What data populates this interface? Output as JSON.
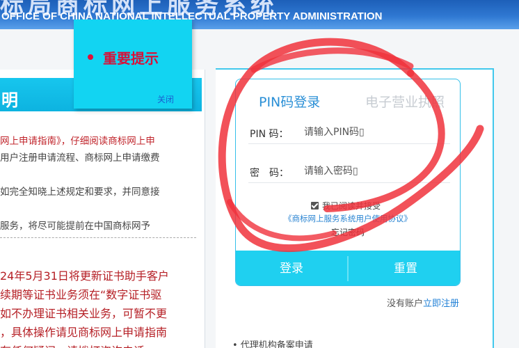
{
  "header": {
    "title_en": "OFFICE OF CHINA NATIONAL INTELLECTUAL PROPERTY ADMINISTRATION",
    "title_cn": "标局商标网上服务系统"
  },
  "popup": {
    "title": "重要提示",
    "close_label": "关闭"
  },
  "notice": {
    "heading": "明",
    "lines": [
      "网上申请指南》，仔细阅读商标网上申",
      "用户注册申请流程、商标网上申请缴费",
      "如完全知晓上述规定和要求，并同意接",
      "服务，将尽可能提前在中国商标网予"
    ],
    "red_lines": [
      "24年5月31日将更新证书助手客户",
      "续期等证书业务须在“数字证书驱",
      "如不办理证书相关业务，可暂不更",
      "，具体操作请见商标网上申请指南",
      "有任何疑问，请拨打咨询电话"
    ]
  },
  "login": {
    "tabs": [
      "PIN码登录",
      "电子营业执照"
    ],
    "pin_label": "PIN 码：",
    "pin_placeholder": "请输入PIN码▯",
    "password_label": "密　码：",
    "password_placeholder": "请输入密码▯",
    "agree_text": "我已阅读并接受",
    "agreement_link": "《商标网上服务系统用户使用协议》",
    "forgot_password": "忘记密码",
    "login_button": "登录",
    "reset_button": "重置"
  },
  "register": {
    "prompt": "没有账户",
    "link": "立即注册"
  },
  "agent": {
    "link": "• 代理机构备案申请"
  },
  "colors": {
    "accent_cyan": "#1fd0f0",
    "link_blue": "#2a84d2",
    "alert_red": "#d6123a",
    "annotation_red": "#f0323c"
  }
}
